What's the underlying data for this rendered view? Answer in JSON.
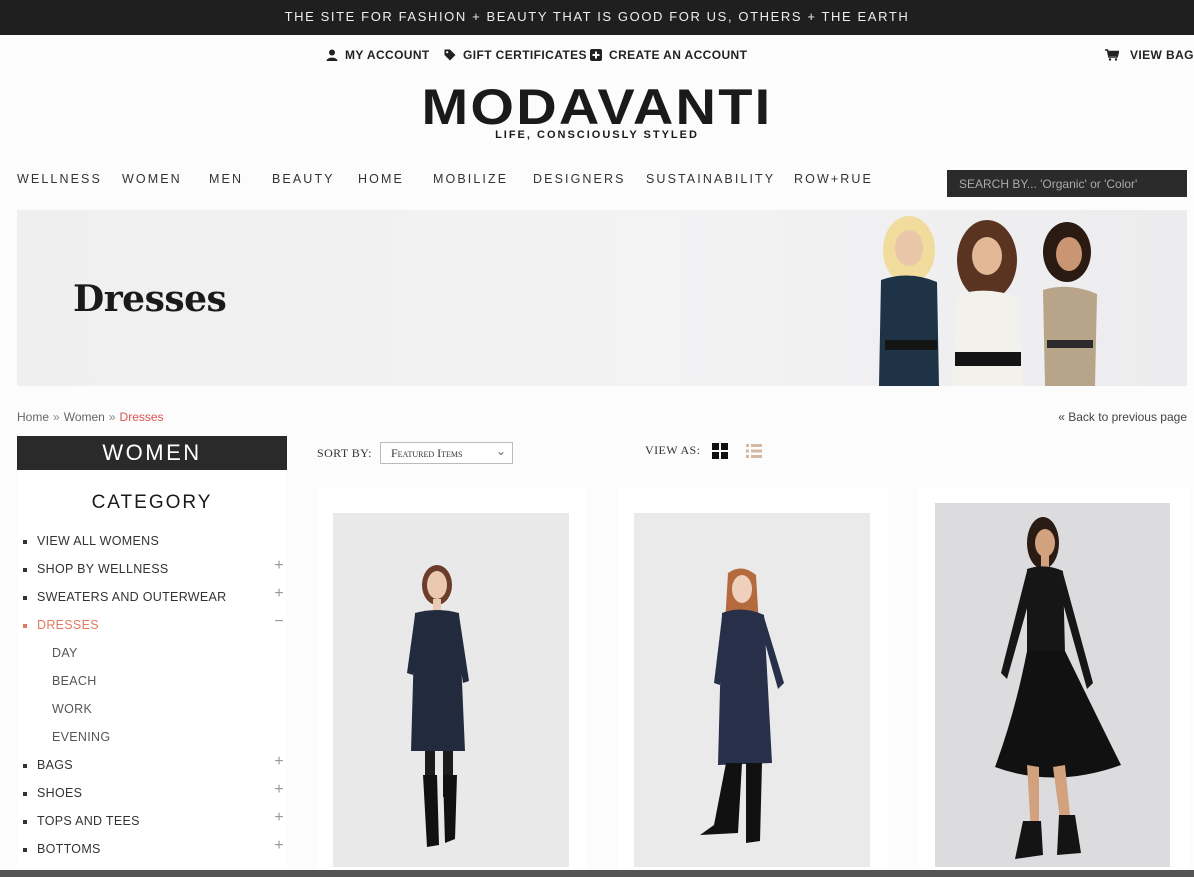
{
  "promo": {
    "text": "THE SITE FOR FASHION + BEAUTY THAT IS GOOD FOR US, OTHERS + THE EARTH"
  },
  "account_links": [
    {
      "label": "MY ACCOUNT",
      "icon": "user-icon"
    },
    {
      "label": "GIFT CERTIFICATES",
      "icon": "tag-icon"
    },
    {
      "label": "CREATE AN ACCOUNT",
      "icon": "plus-square-icon"
    }
  ],
  "cart": {
    "label": "VIEW BAG",
    "icon": "cart-icon"
  },
  "brand": {
    "name": "MODAVANTI",
    "tagline": "LIFE, CONSCIOUSLY STYLED"
  },
  "nav": [
    "WELLNESS",
    "WOMEN",
    "MEN",
    "BEAUTY",
    "HOME",
    "MOBILIZE",
    "DESIGNERS",
    "SUSTAINABILITY",
    "ROW+RUE"
  ],
  "search": {
    "placeholder": "SEARCH BY... 'Organic' or 'Color'"
  },
  "banner": {
    "title": "Dresses"
  },
  "breadcrumb": {
    "items": [
      "Home",
      "Women"
    ],
    "current": "Dresses",
    "separator": "»"
  },
  "back_link": "« Back to previous page",
  "sidebar": {
    "heading": "WOMEN",
    "category_title": "CATEGORY",
    "items": [
      {
        "label": "VIEW ALL WOMENS",
        "toggle": ""
      },
      {
        "label": "SHOP BY WELLNESS",
        "toggle": "+"
      },
      {
        "label": "SWEATERS AND OUTERWEAR",
        "toggle": "+"
      },
      {
        "label": "DRESSES",
        "toggle": "−"
      },
      {
        "label": "DAY",
        "toggle": ""
      },
      {
        "label": "BEACH",
        "toggle": ""
      },
      {
        "label": "WORK",
        "toggle": ""
      },
      {
        "label": "EVENING",
        "toggle": ""
      },
      {
        "label": "BAGS",
        "toggle": "+"
      },
      {
        "label": "SHOES",
        "toggle": "+"
      },
      {
        "label": "TOPS AND TEES",
        "toggle": "+"
      },
      {
        "label": "BOTTOMS",
        "toggle": "+"
      }
    ]
  },
  "toolbar": {
    "sort_label": "SORT BY:",
    "sort_value": "Featured Items",
    "view_label": "VIEW AS:"
  },
  "colors": {
    "accent": "#e07a5f",
    "dark": "#1f1f1f",
    "breadcrumb_current": "#d9534f"
  }
}
